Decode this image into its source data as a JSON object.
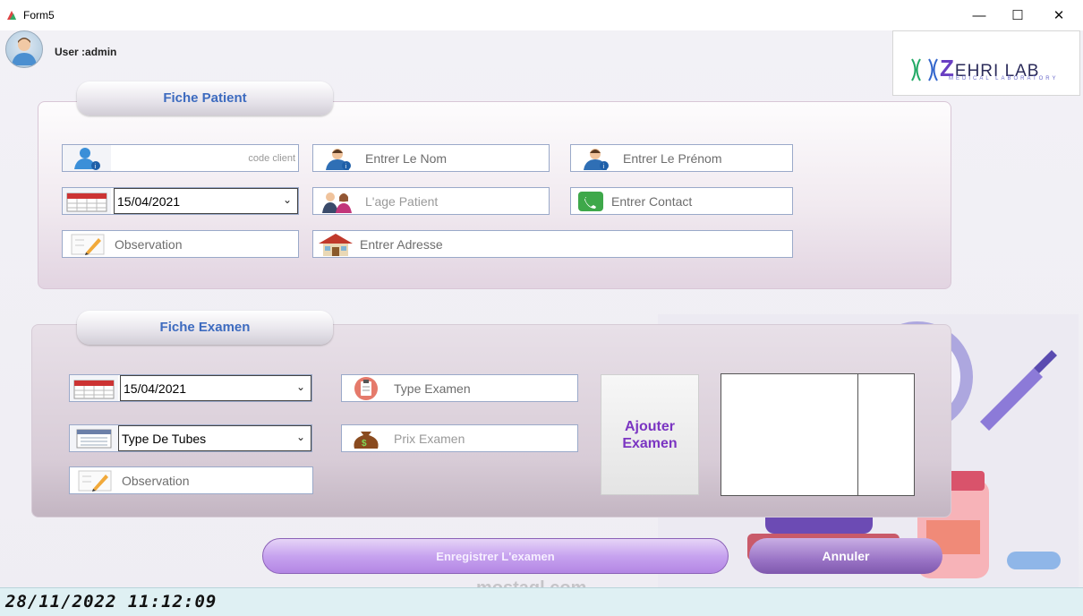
{
  "window": {
    "title": "Form5",
    "minimize": "—",
    "maximize": "☐",
    "close": "✕"
  },
  "user": {
    "label": "User :admin"
  },
  "logo": {
    "brand_z": "Z",
    "brand_rest": "EHRI LAB",
    "subtitle": "MEDICAL LABORATORY"
  },
  "patient": {
    "tab_label": "Fiche Patient",
    "code_client_placeholder": "code client",
    "nom_placeholder": "Entrer Le Nom",
    "prenom_placeholder": "Entrer Le Prénom",
    "date_value": "15/04/2021",
    "age_placeholder": "L'age Patient",
    "contact_placeholder": "Entrer Contact",
    "observation_placeholder": "Observation",
    "adresse_placeholder": "Entrer Adresse"
  },
  "exam": {
    "tab_label": "Fiche Examen",
    "date_value": "15/04/2021",
    "type_examen_placeholder": "Type Examen",
    "type_tubes_value": "Type De Tubes",
    "prix_placeholder": "Prix Examen",
    "observation_placeholder": "Observation",
    "add_button": "Ajouter Examen"
  },
  "actions": {
    "save": "Enregistrer L'examen",
    "cancel": "Annuler"
  },
  "status": {
    "datetime": "28/11/2022 11:12:09"
  },
  "watermark": "mostaql.com",
  "colors": {
    "accent_purple": "#7b35c2",
    "tab_blue": "#3d6bbf"
  }
}
